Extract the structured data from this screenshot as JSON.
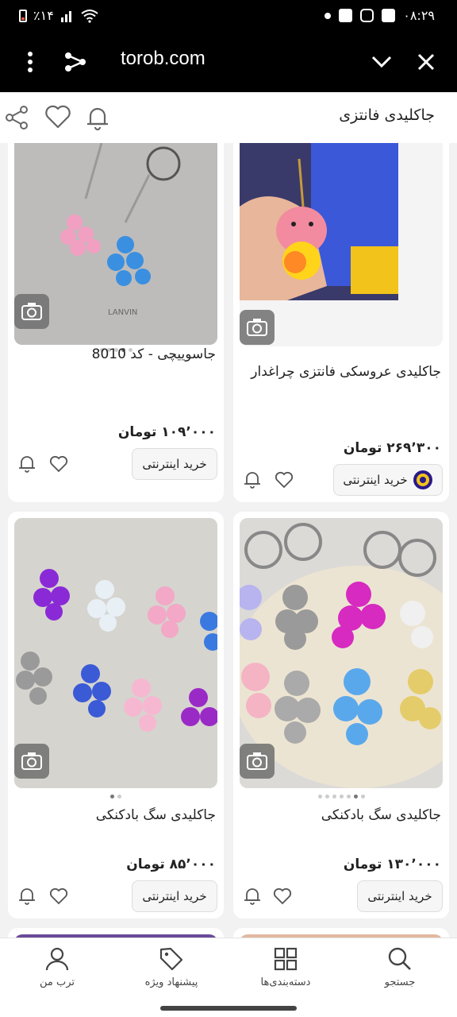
{
  "status_bar": {
    "time": "۰۸:۲۹",
    "battery": "٪۱۴"
  },
  "browser": {
    "url": "torob.com"
  },
  "header": {
    "title": "جاکلیدی فانتزی"
  },
  "products": [
    {
      "name": "جاکلیدی عروسکی فانتزی چراغدار",
      "price": "۲۶۹٬۳۰۰ تومان",
      "buy_label": "خرید اینترنتی"
    },
    {
      "name": "جاسوییچی - کد 8010",
      "price": "۱۰۹٬۰۰۰ تومان",
      "buy_label": "خرید اینترنتی"
    },
    {
      "name": "جاکلیدی سگ بادکنکی",
      "price": "۱۳۰٬۰۰۰ تومان",
      "buy_label": "خرید اینترنتی"
    },
    {
      "name": "جاکلیدی سگ بادکنکی",
      "price": "۸۵٬۰۰۰ تومان",
      "buy_label": "خرید اینترنتی"
    }
  ],
  "bottom_nav": [
    {
      "label": "جستجو",
      "icon": "search-icon"
    },
    {
      "label": "دسته‌بندی‌ها",
      "icon": "grid-icon"
    },
    {
      "label": "پیشنهاد ویژه",
      "icon": "tag-icon"
    },
    {
      "label": "ترب من",
      "icon": "user-icon"
    }
  ]
}
